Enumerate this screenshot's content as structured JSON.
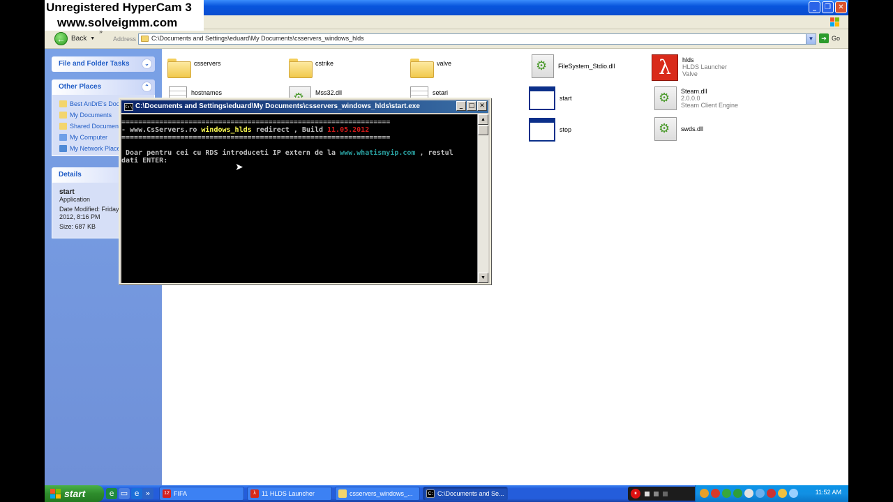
{
  "watermark": {
    "line1": "Unregistered HyperCam 3",
    "line2": "www.solveigmm.com"
  },
  "toolbar": {
    "back_label": "Back",
    "address_label": "Address",
    "go_label": "Go"
  },
  "address": {
    "path": "C:\\Documents and Settings\\eduard\\My Documents\\csservers_windows_hlds"
  },
  "taskpane": {
    "file_folder_tasks": "File and Folder Tasks",
    "other_places_title": "Other Places",
    "other_places": [
      {
        "label": "Best AnDrE's Doc",
        "icon": "folder-icon",
        "color": "#f3d56c"
      },
      {
        "label": "My Documents",
        "icon": "folder-icon",
        "color": "#f3d56c"
      },
      {
        "label": "Shared Documents",
        "icon": "folder-icon",
        "color": "#f3d56c"
      },
      {
        "label": "My Computer",
        "icon": "computer-icon",
        "color": "#6fa0e8"
      },
      {
        "label": "My Network Places",
        "icon": "network-icon",
        "color": "#4f8ad6"
      }
    ],
    "details_title": "Details",
    "details": {
      "name": "start",
      "type": "Application",
      "modified": "Date Modified: Friday,",
      "modified2": "2012, 8:16 PM",
      "size": "Size: 687 KB"
    }
  },
  "files": [
    {
      "name": "csservers",
      "kind": "folder"
    },
    {
      "name": "cstrike",
      "kind": "folder"
    },
    {
      "name": "valve",
      "kind": "folder"
    },
    {
      "name": "FileSystem_Stdio.dll",
      "kind": "dll"
    },
    {
      "name": "hlds",
      "sub1": "HLDS Launcher",
      "sub2": "Valve",
      "kind": "hlds"
    },
    {
      "name": "hostnames",
      "kind": "text"
    },
    {
      "name": "Mss32.dll",
      "kind": "dll"
    },
    {
      "name": "setari",
      "kind": "text"
    },
    {
      "name": "start",
      "kind": "exe"
    },
    {
      "name": "Steam.dll",
      "sub1": "2.0.0.0",
      "sub2": "Steam Client Engine",
      "kind": "dll"
    },
    {
      "name": "stop",
      "kind": "exe"
    },
    {
      "name": "swds.dll",
      "kind": "dll"
    }
  ],
  "console": {
    "title": "C:\\Documents and Settings\\eduard\\My Documents\\csservers_windows_hlds\\start.exe",
    "sep": "================================================================",
    "line_prefix": "- www.CsServers.ro ",
    "line_hl": "windows_hlds",
    "line_mid": " redirect , Build ",
    "line_build": "11.05.2012",
    "prompt1a": " Doar pentru cei cu RDS introduceti IP extern de la ",
    "prompt1_url": "www.whatismyip.com",
    "prompt1b": " , restul",
    "prompt2": "dati ENTER:"
  },
  "taskbar": {
    "start_label": "start",
    "tasks": [
      {
        "label": "FIFA",
        "icon": "fifa-icon",
        "color": "#d42020"
      },
      {
        "label": "11 HLDS Launcher",
        "icon": "hlds-icon",
        "color": "#d92a1a"
      },
      {
        "label": "csservers_windows_...",
        "icon": "folder-icon",
        "color": "#f3d56c"
      },
      {
        "label": "C:\\Documents and Se...",
        "icon": "console-icon",
        "color": "#000000"
      }
    ],
    "clock": "11:52 AM"
  }
}
